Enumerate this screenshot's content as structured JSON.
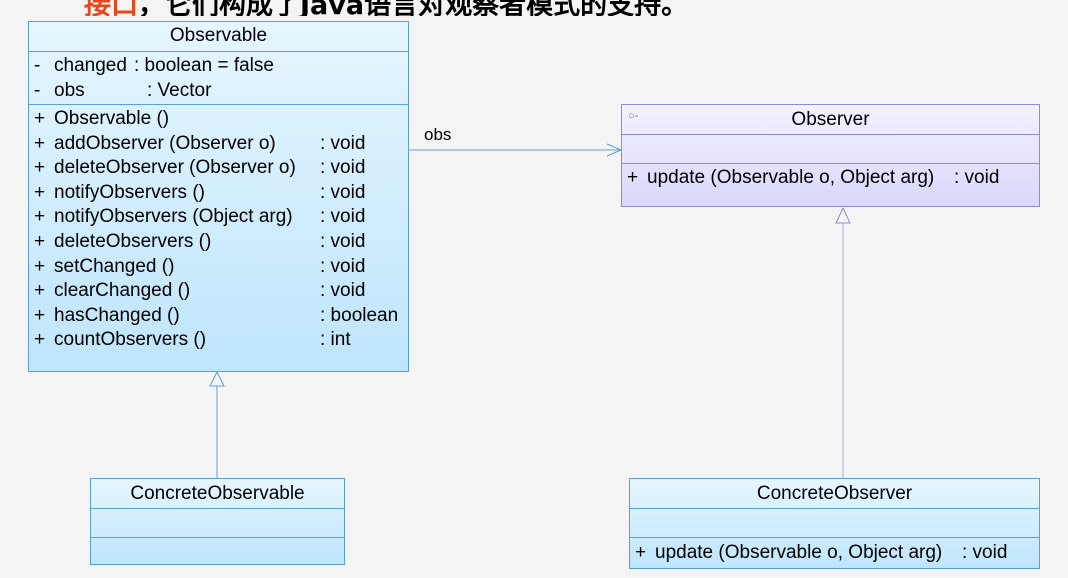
{
  "header": {
    "accent_text": "接口",
    "rest_text": "，它们构成了Java语言对观察者模式的支持。"
  },
  "observable": {
    "name": "Observable",
    "attributes": [
      {
        "vis": "-",
        "name": "changed",
        "type": ": boolean   = false"
      },
      {
        "vis": "-",
        "name": "obs",
        "type": ": Vector"
      }
    ],
    "operations": [
      {
        "vis": "+",
        "name": "Observable ()",
        "type": ""
      },
      {
        "vis": "+",
        "name": "addObserver (Observer o)",
        "type": ": void"
      },
      {
        "vis": "+",
        "name": "deleteObserver (Observer o)",
        "type": ": void"
      },
      {
        "vis": "+",
        "name": "notifyObservers ()",
        "type": ": void"
      },
      {
        "vis": "+",
        "name": "notifyObservers (Object arg)",
        "type": ": void"
      },
      {
        "vis": "+",
        "name": "deleteObservers ()",
        "type": ": void"
      },
      {
        "vis": "+",
        "name": "setChanged ()",
        "type": ": void"
      },
      {
        "vis": "+",
        "name": "clearChanged ()",
        "type": ": void"
      },
      {
        "vis": "+",
        "name": "hasChanged ()",
        "type": ": boolean"
      },
      {
        "vis": "+",
        "name": "countObservers ()",
        "type": ": int"
      }
    ]
  },
  "observer": {
    "name": "Observer",
    "stereotype_icon": "interface-lollipop-icon",
    "operation": {
      "vis": "+",
      "name": "update (Observable o, Object arg)",
      "type": ": void"
    }
  },
  "concrete_observable": {
    "name": "ConcreteObservable"
  },
  "concrete_observer": {
    "name": "ConcreteObserver",
    "operation": {
      "vis": "+",
      "name": "update (Observable o, Object arg)",
      "type": ": void"
    }
  },
  "association": {
    "label": "obs"
  },
  "colors": {
    "class_border": "#5b9fd6",
    "interface_border": "#8c8ccf",
    "accent": "#e8461b",
    "line": "#5b9fd6"
  }
}
